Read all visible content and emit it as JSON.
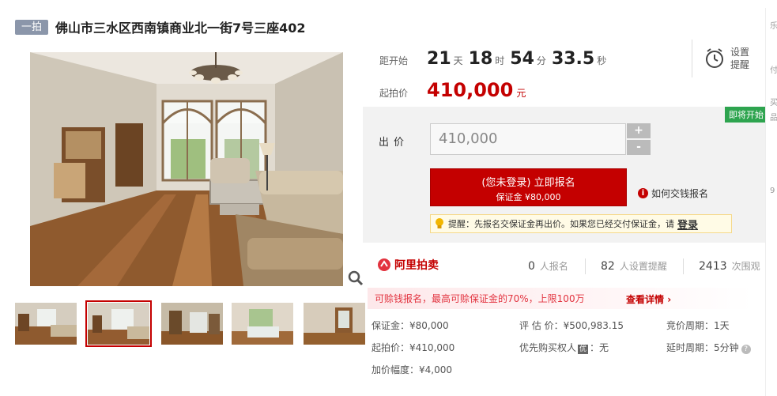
{
  "header": {
    "tag": "一拍",
    "title": "佛山市三水区西南镇商业北一街7号三座402"
  },
  "countdown": {
    "label": "距开始",
    "days": "21",
    "days_unit": "天",
    "hours": "18",
    "hours_unit": "时",
    "minutes": "54",
    "minutes_unit": "分",
    "seconds": "33.5",
    "seconds_unit": "秒"
  },
  "remind": {
    "line1": "设置",
    "line2": "提醒",
    "icon": "alarm-clock-icon"
  },
  "start_price": {
    "label": "起拍价",
    "value": "410,000",
    "unit": "元"
  },
  "bid": {
    "badge": "即将开始",
    "label": "出价",
    "input_value": "410,000",
    "plus": "+",
    "minus": "-",
    "apply_line1": "(您未登录) 立即报名",
    "apply_line2": "保证金 ¥80,000",
    "howto": "如何交钱报名",
    "tip_prefix": "提醒：先报名交保证金再出价。如果您已经交付保证金，请",
    "tip_login": "登录"
  },
  "brand": {
    "name": "阿里拍卖"
  },
  "stats": [
    {
      "n": "0",
      "label": "人报名"
    },
    {
      "n": "82",
      "label": "人设置提醒"
    },
    {
      "n": "2413",
      "label": "次围观"
    }
  ],
  "promo": {
    "text": "可赊钱报名，最高可赊保证金的70%，上限100万",
    "link": "查看详情"
  },
  "details": {
    "deposit": "保证金：¥80,000",
    "appraisal": "评 估 价：¥500,983.15",
    "cycle": "竞价周期：1天",
    "start": "起拍价：¥410,000",
    "priority_pre": "优先购买权人",
    "priority_badge": "优",
    "priority_post": "：无",
    "delay": "延时周期：5分钟",
    "increment": "加价幅度：¥4,000"
  },
  "edge": {
    "a": "乐",
    "b": "付",
    "c": "买",
    "d": "品",
    "e": "9"
  },
  "colors": {
    "accent": "#c40000",
    "green": "#2ea44f",
    "tag": "#8b96aa"
  }
}
